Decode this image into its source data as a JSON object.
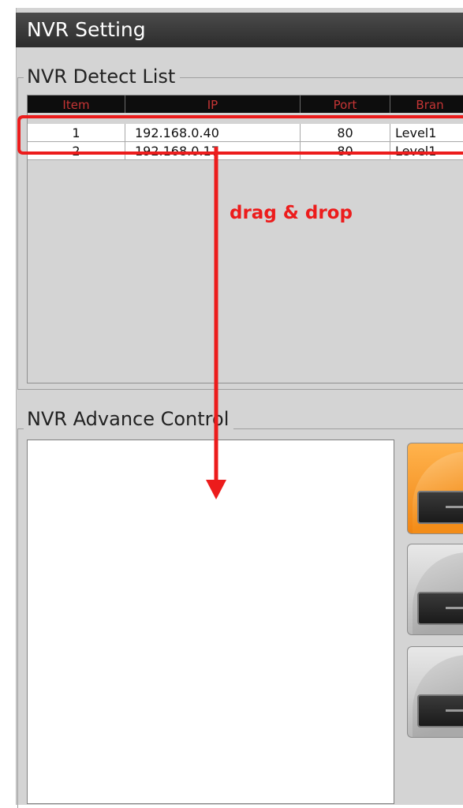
{
  "window": {
    "title": "NVR Setting"
  },
  "detect_list": {
    "label": "NVR  Detect List",
    "columns": {
      "item": "Item",
      "ip": "IP",
      "port": "Port",
      "brand": "Bran"
    },
    "rows": [
      {
        "item": "1",
        "ip": "192.168.0.40",
        "port": "80",
        "brand": "Level1"
      },
      {
        "item": "2",
        "ip": "192.168.0.17",
        "port": "80",
        "brand": "Level1"
      }
    ]
  },
  "annotation": {
    "text": "drag & drop",
    "color": "#ec1c1c"
  },
  "advance_control": {
    "label": "NVR  Advance Control"
  },
  "nvr_buttons": [
    {
      "name": "nvr-button-1",
      "state": "active",
      "color": "#f08513"
    },
    {
      "name": "nvr-button-2",
      "state": "inactive",
      "color": "#b9b9b9"
    },
    {
      "name": "nvr-button-3",
      "state": "inactive",
      "color": "#b9b9b9"
    }
  ]
}
